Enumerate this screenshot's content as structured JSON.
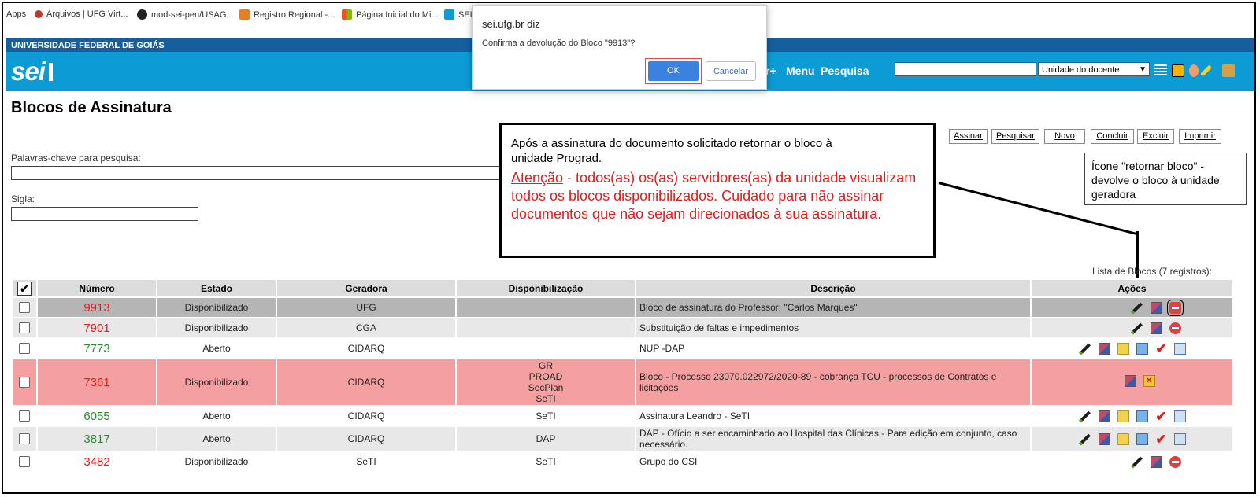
{
  "bookmarks": [
    {
      "label": "Apps",
      "icon": "apps-icon",
      "color": "#4285f4"
    },
    {
      "label": "Arquivos | UFG Virt...",
      "icon": "ufg-icon",
      "color": "#c0392b"
    },
    {
      "label": "mod-sei-pen/USAG...",
      "icon": "github-icon",
      "color": "#222222"
    },
    {
      "label": "Registro Regional -...",
      "icon": "joomla-icon",
      "color": "#e67e22"
    },
    {
      "label": "Página Inicial do Mi...",
      "icon": "microsoft-icon",
      "color": "#f25022"
    },
    {
      "label": "SEI",
      "icon": "sei-icon",
      "color": "#0d9bd6"
    }
  ],
  "header": {
    "institution": "UNIVERSIDADE FEDERAL DE GOIÁS",
    "logo": "sei",
    "nav_partial": "r+",
    "menu_label": "Menu",
    "search_label": "Pesquisa",
    "search_value": "",
    "unit_select": "Unidade do docente",
    "brand_color": "#0d9bd6",
    "top_color": "#155f9e"
  },
  "page": {
    "title": "Blocos de Assinatura",
    "keywords_label": "Palavras-chave para pesquisa:",
    "keywords_value": "",
    "sigla_label": "Sigla:",
    "sigla_value": ""
  },
  "toolbar": [
    "Assinar",
    "Pesquisar",
    "Novo",
    "Concluir",
    "Excluir",
    "Imprimir"
  ],
  "callout_main": {
    "note": "Após a assinatura do documento solicitado retornar o bloco à unidade Prograd.",
    "warn_title": "Atenção",
    "warn_text": " - todos(as) os(as) servidores(as) da unidade visualizam todos os blocos disponibilizados. Cuidado para não assinar documentos que não sejam direcionados à sua assinatura."
  },
  "callout_icon": "Ícone \"retornar bloco\" - devolve o bloco à unidade geradora",
  "table": {
    "caption": "Lista de Blocos (7 registros):",
    "headers": [
      "Número",
      "Estado",
      "Geradora",
      "Disponibilização",
      "Descrição",
      "Ações"
    ],
    "rows": [
      {
        "numero": "9913",
        "estado": "Disponibilizado",
        "geradora": "UFG",
        "disp": "",
        "desc": "Bloco de assinatura do Professor: \"Carlos Marques\""
      },
      {
        "numero": "7901",
        "estado": "Disponibilizado",
        "geradora": "CGA",
        "disp": "",
        "desc": "Substituição de faltas e impedimentos"
      },
      {
        "numero": "7773",
        "estado": "Aberto",
        "geradora": "CIDARQ",
        "disp": "",
        "desc": "NUP -DAP"
      },
      {
        "numero": "7361",
        "estado": "Disponibilizado",
        "geradora": "CIDARQ",
        "disp": "GR\nPROAD\nSecPlan\nSeTI",
        "desc": "Bloco - Processo 23070.022972/2020-89 - cobrança TCU - processos de Contratos e licitações"
      },
      {
        "numero": "6055",
        "estado": "Aberto",
        "geradora": "CIDARQ",
        "disp": "SeTI",
        "desc": "Assinatura Leandro - SeTI"
      },
      {
        "numero": "3817",
        "estado": "Aberto",
        "geradora": "CIDARQ",
        "disp": "DAP",
        "desc": "DAP - Ofício a ser encaminhado ao Hospital das Clínicas - Para edição em conjunto, caso necessário."
      },
      {
        "numero": "3482",
        "estado": "Disponibilizado",
        "geradora": "SeTI",
        "disp": "SeTI",
        "desc": "Grupo do CSI"
      }
    ]
  },
  "dialog": {
    "title": "sei.ufg.br diz",
    "message": "Confirma a devolução do Bloco \"9913\"?",
    "ok": "OK",
    "cancel": "Cancelar"
  }
}
